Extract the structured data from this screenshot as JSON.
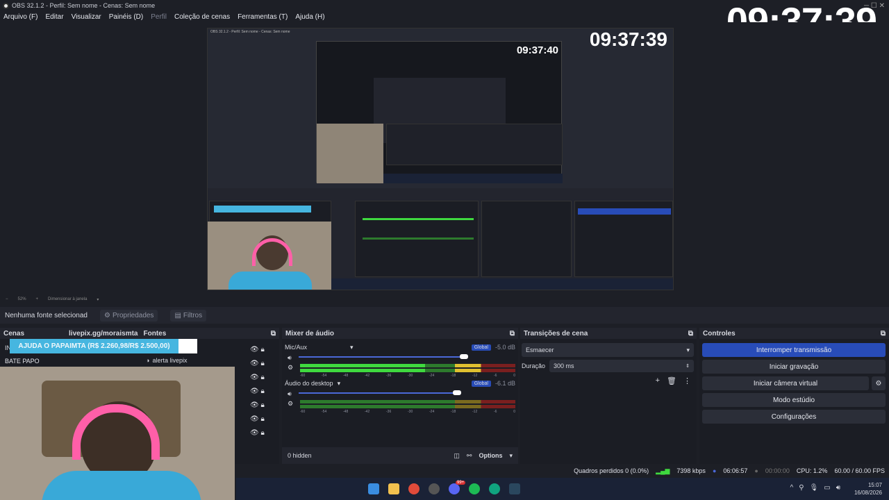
{
  "window": {
    "title": "OBS 32.1.2 - Perfil: Sem nome - Cenas: Sem nome"
  },
  "menu": {
    "items": [
      "Arquivo (F)",
      "Editar",
      "Visualizar",
      "Painéis (D)",
      "Perfil",
      "Coleção de cenas",
      "Ferramentas (T)",
      "Ajuda (H)"
    ]
  },
  "clock": "09:37:39",
  "preview": {
    "nested_clock": "09:37:39",
    "nested_clock2": "09:37:40"
  },
  "zoom": {
    "percent": "52%",
    "mode": "Dimensionar à janela"
  },
  "source_bar": {
    "no_source": "Nenhuma fonte selecionad",
    "properties": "Propriedades",
    "filters": "Filtros"
  },
  "scenes": {
    "title": "Cenas",
    "overlay_url": "livepix.gg/moraismta",
    "items": [
      "IN",
      "BATE PAPO"
    ],
    "alert": "AJUDA O PAPAIMTA (R$ 2.260,98/R$ 2.500,00)",
    "alert_progress": 0.9
  },
  "sources": {
    "title": "Fontes",
    "items": [
      "alerta livepix"
    ]
  },
  "mixer": {
    "title": "Mixer de áudio",
    "channels": [
      {
        "name": "Mic/Aux",
        "badge": "Global",
        "db": "-5.0 dB",
        "volume": 0.79
      },
      {
        "name": "Áudio do desktop",
        "badge": "Global",
        "db": "-6.1 dB",
        "volume": 0.75
      }
    ],
    "scale": [
      "-60",
      "-54",
      "-48",
      "-42",
      "-36",
      "-30",
      "-24",
      "-18",
      "-12",
      "-6",
      "0"
    ],
    "hidden": "0 hidden",
    "options": "Options"
  },
  "transitions": {
    "title": "Transições de cena",
    "selected": "Esmaecer",
    "duration_label": "Duração",
    "duration_value": "300 ms"
  },
  "controls": {
    "title": "Controles",
    "buttons": [
      "Interromper transmissão",
      "Iniciar gravação",
      "Iniciar câmera virtual",
      "Modo estúdio",
      "Configurações"
    ]
  },
  "status": {
    "dropped": "Quadros perdidos 0 (0.0%)",
    "bitrate": "7398 kbps",
    "stream_time": "06:06:57",
    "rec_time": "00:00:00",
    "cpu": "CPU: 1.2%",
    "fps": "60.00 / 60.00 FPS"
  },
  "taskbar": {
    "time": "15:07",
    "date": "16/08/2026",
    "notification_badge": "99+"
  },
  "colors": {
    "accent": "#284cb8",
    "background": "#1d1f26",
    "panel": "#1b1d24",
    "alert": "#46b6e0"
  }
}
